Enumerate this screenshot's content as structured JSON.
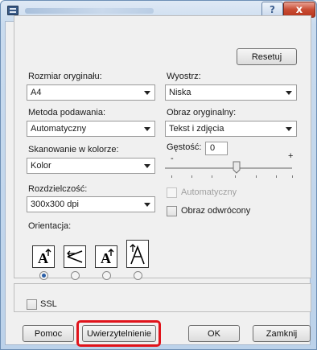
{
  "window": {
    "help_label": "?",
    "close_label": "x"
  },
  "reset_label": "Resetuj",
  "left": {
    "size_label": "Rozmiar oryginału:",
    "size_value": "A4",
    "feed_label": "Metoda podawania:",
    "feed_value": "Automatyczny",
    "color_label": "Skanowanie w kolorze:",
    "color_value": "Kolor",
    "res_label": "Rozdzielczość:",
    "res_value": "300x300 dpi",
    "orient_label": "Orientacja:",
    "orient_selected_index": 0
  },
  "right": {
    "sharpen_label": "Wyostrz:",
    "sharpen_value": "Niska",
    "original_label": "Obraz oryginalny:",
    "original_value": "Tekst i zdjęcia",
    "density_label": "Gęstość:",
    "density_value": "0",
    "minus": "-",
    "plus": "+",
    "auto_label": "Automatyczny",
    "invert_label": "Obraz odwrócony"
  },
  "ssl_label": "SSL",
  "footer": {
    "help_label": "Pomoc",
    "auth_label": "Uwierzytelnienie",
    "ok_label": "OK",
    "close_label": "Zamknij"
  },
  "colors": {
    "highlight": "#e0131b",
    "title_gradient": "#c9dbee"
  },
  "icons": [
    "app-icon",
    "help-icon",
    "close-icon",
    "orientation-icon"
  ]
}
